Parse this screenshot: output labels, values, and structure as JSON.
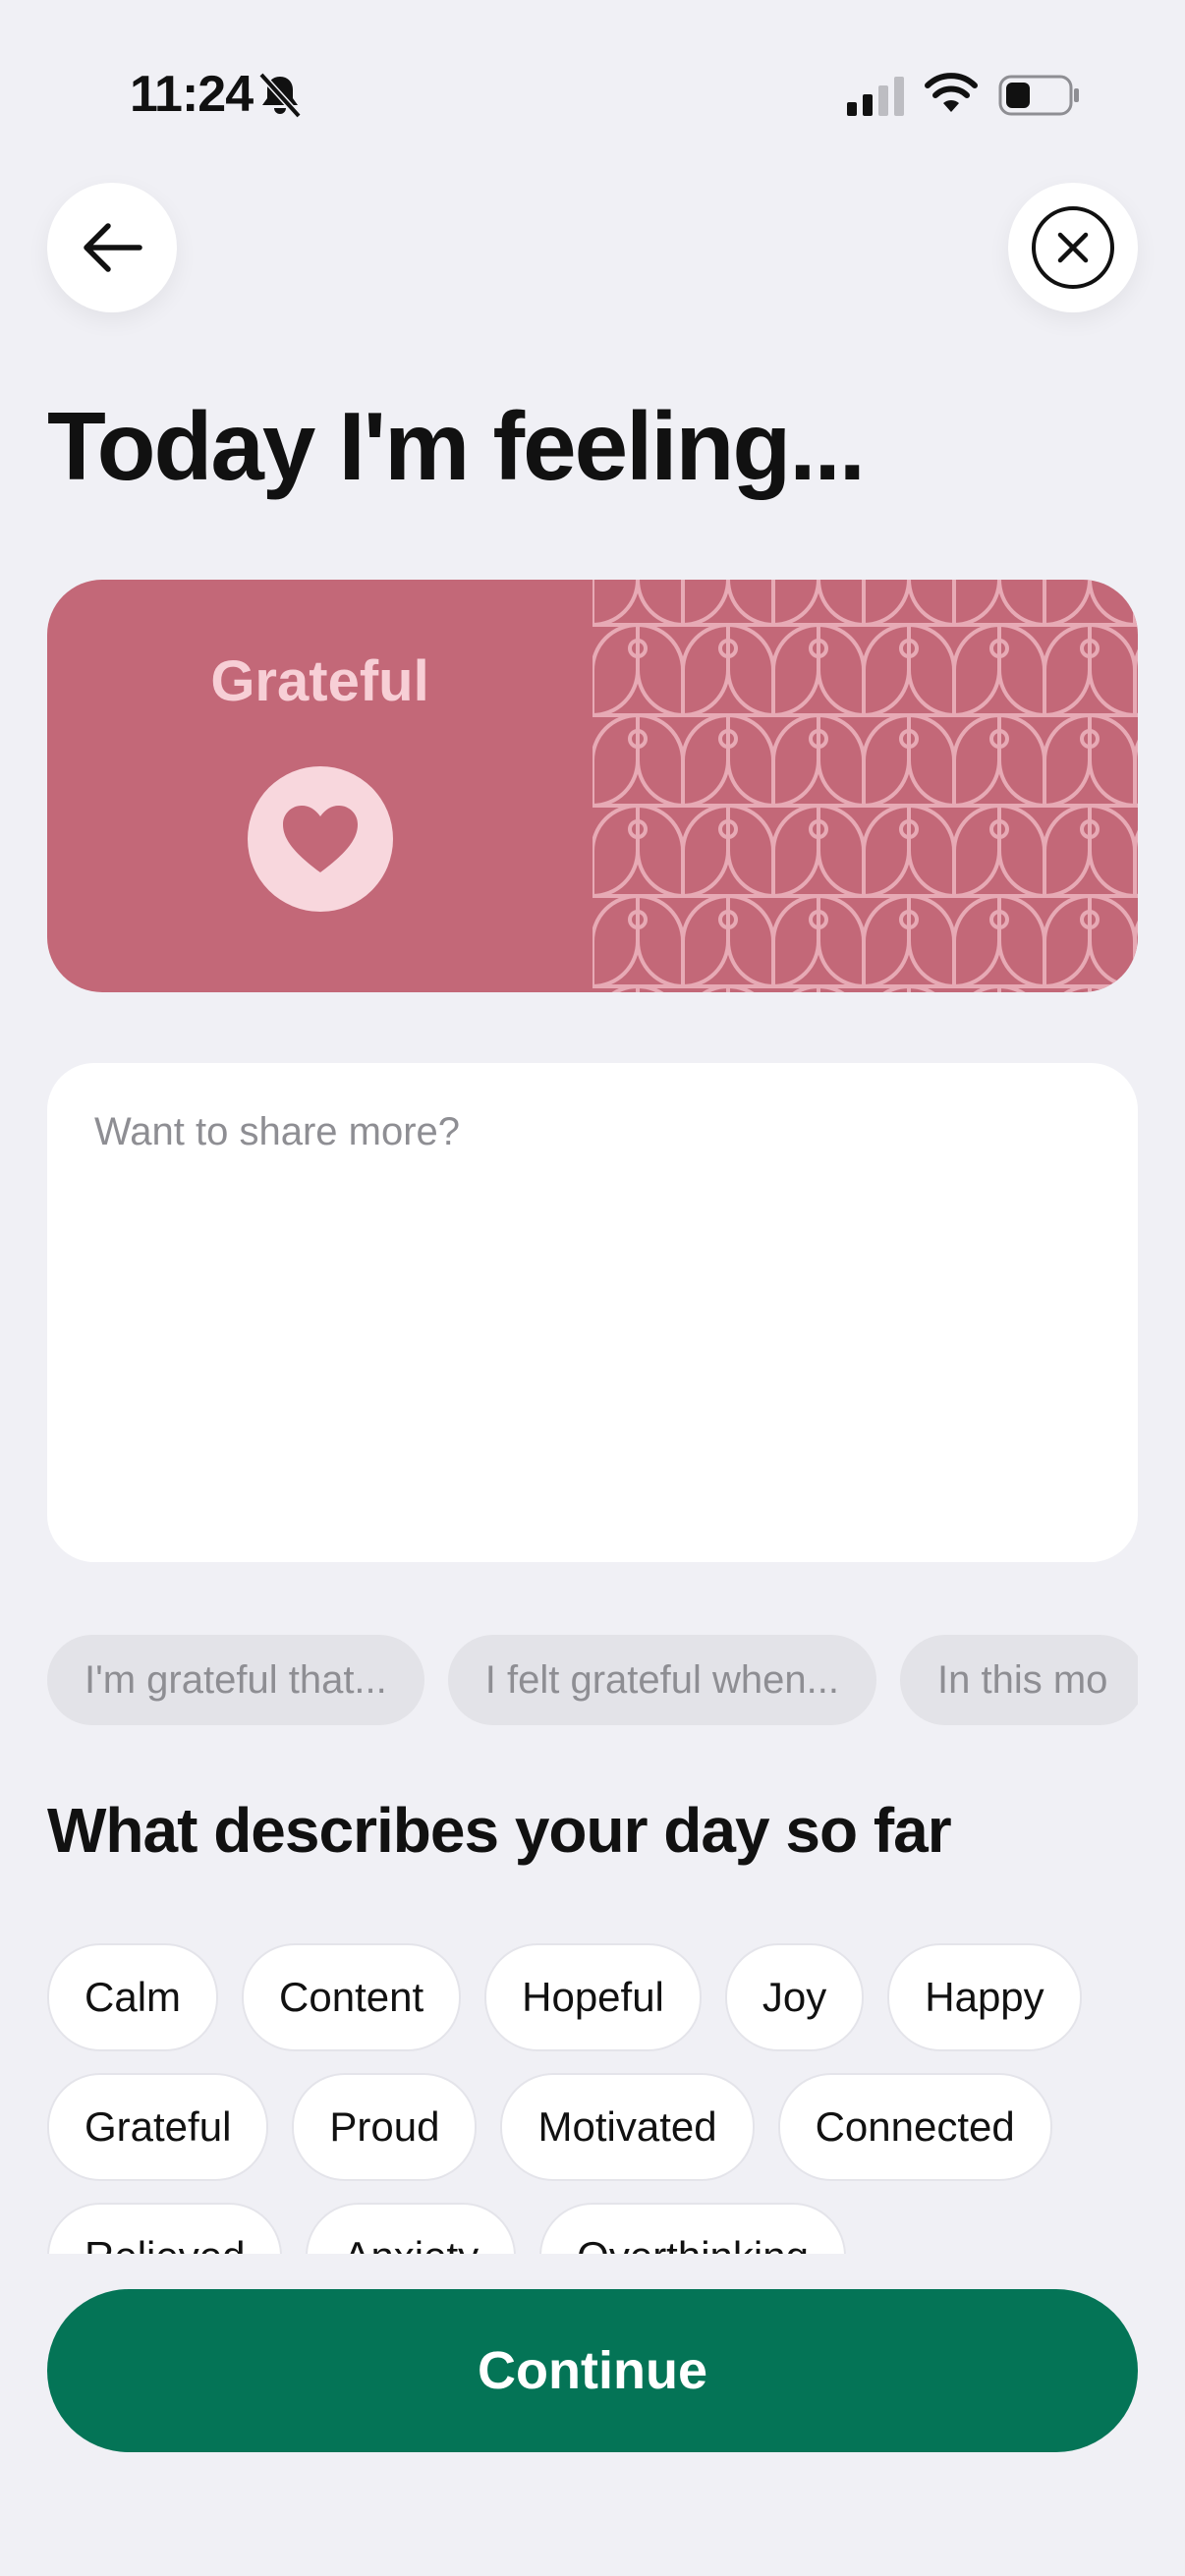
{
  "status_bar": {
    "time": "11:24"
  },
  "page_title": "Today I'm feeling...",
  "mood": {
    "label": "Grateful",
    "icon": "heart-icon",
    "color": "#c36878"
  },
  "share": {
    "placeholder": "Want to share more?",
    "value": ""
  },
  "prompts": [
    "I'm grateful that...",
    "I felt grateful when...",
    "In this mo"
  ],
  "section_title": "What describes your day so far",
  "tags": {
    "row1": [
      "Calm",
      "Content",
      "Hopeful",
      "Joy",
      "Happy"
    ],
    "row2": [
      "Grateful",
      "Proud",
      "Motivated",
      "Connected"
    ],
    "row3": [
      "Relieved",
      "Anxiety",
      "Overthinking"
    ]
  },
  "continue_label": "Continue",
  "colors": {
    "accent": "#047456",
    "background": "#f0f0f5"
  }
}
